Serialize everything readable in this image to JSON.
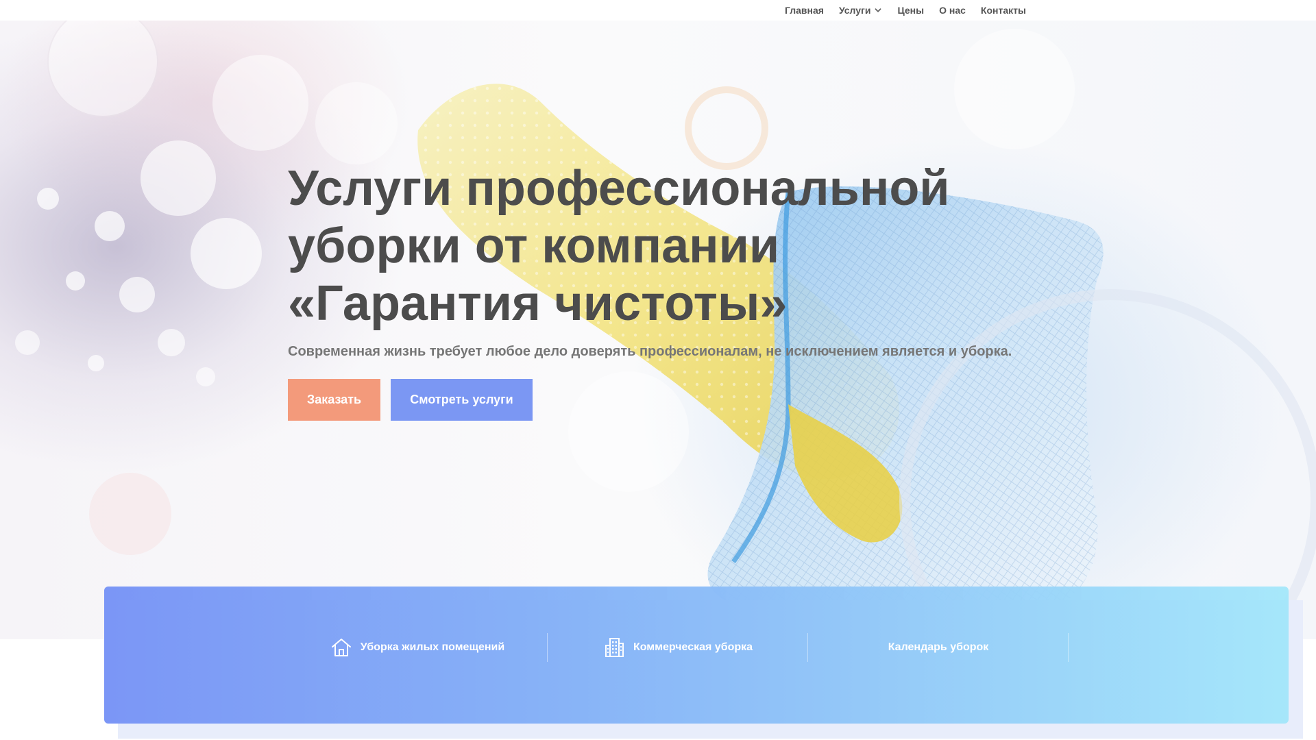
{
  "nav": {
    "items": [
      {
        "label": "Главная"
      },
      {
        "label": "Услуги"
      },
      {
        "label": "Цены"
      },
      {
        "label": "О нас"
      },
      {
        "label": "Контакты"
      }
    ]
  },
  "hero": {
    "title": "Услуги профессиональной уборки от компании «Гарантия чистоты»",
    "subtitle": "Современная жизнь требует любое дело доверять профессионалам, не исключением является и уборка.",
    "buttons": {
      "order": "Заказать",
      "services": "Смотреть услуги"
    }
  },
  "services_panel": {
    "items": [
      {
        "label": "Уборка жилых помещений",
        "icon": "house-icon"
      },
      {
        "label": "Коммерческая уборка",
        "icon": "building-icon"
      },
      {
        "label": "Календарь уборок",
        "icon": ""
      }
    ]
  },
  "colors": {
    "order_button": "#f39a7b",
    "services_button": "#7b97f3",
    "panel_start": "#7b96f6",
    "panel_end": "#a0e6fa",
    "title_text": "#4c4c4c"
  }
}
